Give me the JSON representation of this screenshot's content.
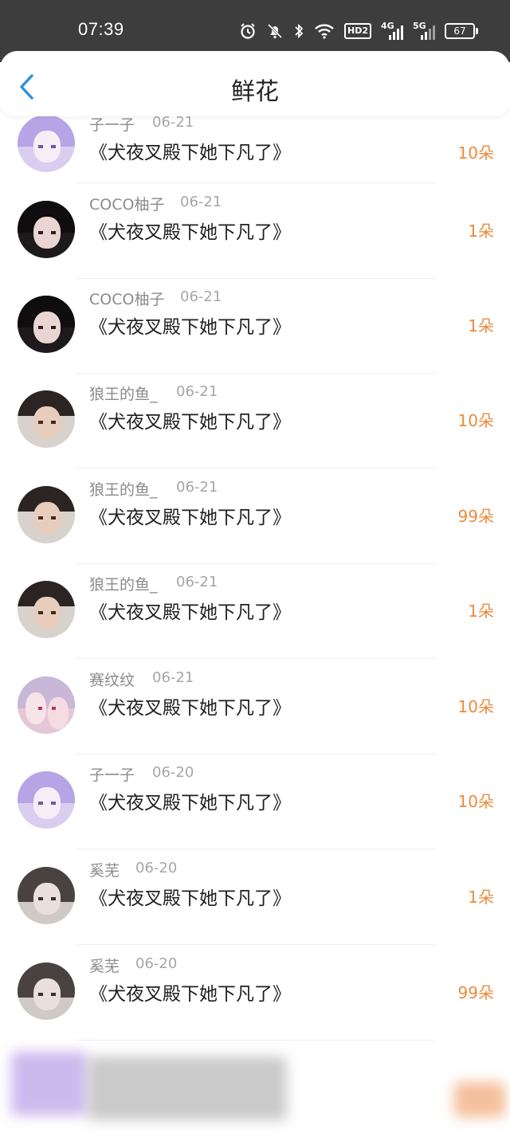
{
  "status_bar": {
    "time": "07:39",
    "hd_label": "HD2",
    "net1_label": "4G",
    "net2_label": "5G",
    "battery": "67"
  },
  "header": {
    "title": "鲜花"
  },
  "colors": {
    "count": "#ec8a3b",
    "name": "#8b8b8b"
  },
  "rows": [
    {
      "name": "子一子",
      "date": "06-21",
      "book": "《犬夜叉殿下她下凡了》",
      "count": "10朵",
      "avatar": "anime-purple"
    },
    {
      "name": "COCO柚子",
      "date": "06-21",
      "book": "《犬夜叉殿下她下凡了》",
      "count": "1朵",
      "avatar": "dark-girl"
    },
    {
      "name": "COCO柚子",
      "date": "06-21",
      "book": "《犬夜叉殿下她下凡了》",
      "count": "1朵",
      "avatar": "dark-girl"
    },
    {
      "name": "狼王的鱼_",
      "date": "06-21",
      "book": "《犬夜叉殿下她下凡了》",
      "count": "10朵",
      "avatar": "boy"
    },
    {
      "name": "狼王的鱼_",
      "date": "06-21",
      "book": "《犬夜叉殿下她下凡了》",
      "count": "99朵",
      "avatar": "boy"
    },
    {
      "name": "狼王的鱼_",
      "date": "06-21",
      "book": "《犬夜叉殿下她下凡了》",
      "count": "1朵",
      "avatar": "boy"
    },
    {
      "name": "赛纹纹",
      "date": "06-21",
      "book": "《犬夜叉殿下她下凡了》",
      "count": "10朵",
      "avatar": "anime-pink"
    },
    {
      "name": "子一子",
      "date": "06-20",
      "book": "《犬夜叉殿下她下凡了》",
      "count": "10朵",
      "avatar": "anime-purple"
    },
    {
      "name": "奚芜",
      "date": "06-20",
      "book": "《犬夜叉殿下她下凡了》",
      "count": "1朵",
      "avatar": "gothic-girl"
    },
    {
      "name": "奚芜",
      "date": "06-20",
      "book": "《犬夜叉殿下她下凡了》",
      "count": "99朵",
      "avatar": "gothic-girl"
    }
  ]
}
